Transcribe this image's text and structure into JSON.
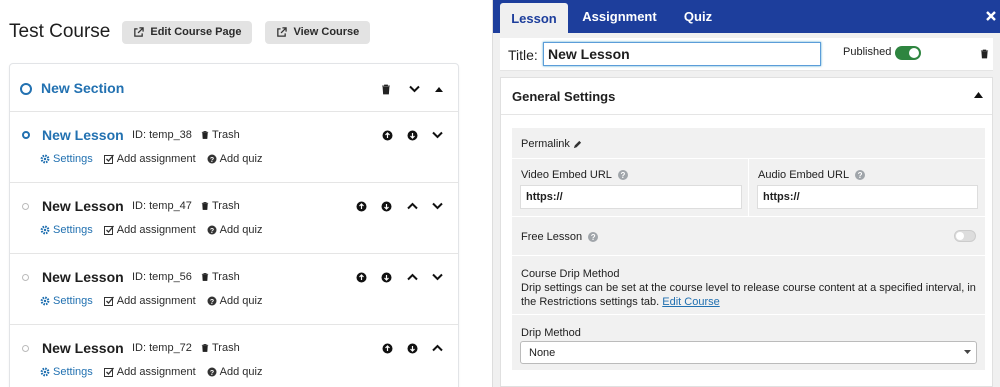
{
  "course": {
    "title": "Test Course",
    "edit_label": "Edit Course Page",
    "view_label": "View Course"
  },
  "section": {
    "title": "New Section"
  },
  "lessons": [
    {
      "title": "New Lesson",
      "id_text": "ID: temp_38",
      "trash": "Trash",
      "settings": "Settings",
      "add_assignment": "Add assignment",
      "add_quiz": "Add quiz",
      "active": true
    },
    {
      "title": "New Lesson",
      "id_text": "ID: temp_47",
      "trash": "Trash",
      "settings": "Settings",
      "add_assignment": "Add assignment",
      "add_quiz": "Add quiz",
      "active": false
    },
    {
      "title": "New Lesson",
      "id_text": "ID: temp_56",
      "trash": "Trash",
      "settings": "Settings",
      "add_assignment": "Add assignment",
      "add_quiz": "Add quiz",
      "active": false
    },
    {
      "title": "New Lesson",
      "id_text": "ID: temp_72",
      "trash": "Trash",
      "settings": "Settings",
      "add_assignment": "Add assignment",
      "add_quiz": "Add quiz",
      "active": false
    }
  ],
  "editor": {
    "tabs": [
      {
        "label": "Lesson",
        "active": true
      },
      {
        "label": "Assignment",
        "active": false
      },
      {
        "label": "Quiz",
        "active": false
      }
    ],
    "title_label": "Title:",
    "title_value": "New Lesson",
    "published_label": "Published",
    "published": true,
    "panel_title": "General Settings",
    "permalink_label": "Permalink",
    "video_label": "Video Embed URL",
    "video_value": "https://",
    "audio_label": "Audio Embed URL",
    "audio_value": "https://",
    "help_glyph": "?",
    "free_lesson_label": "Free Lesson",
    "free_lesson": false,
    "drip_title": "Course Drip Method",
    "drip_desc": "Drip settings can be set at the course level to release course content at a specified interval, in the Restrictions settings tab.",
    "drip_link": "Edit Course",
    "drip_method_label": "Drip Method",
    "drip_method_value": "None"
  },
  "colors": {
    "accent": "#2271b1",
    "tabbar": "#1d3e9c",
    "toggle_on": "#2e8540"
  }
}
